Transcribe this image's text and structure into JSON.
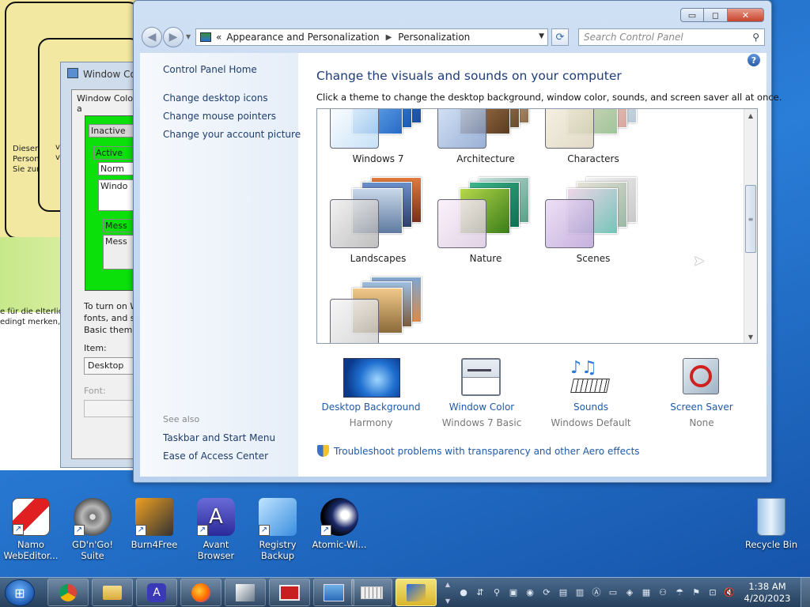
{
  "background_windows": {
    "card_text": [
      "Dieser .",
      "Person",
      "Sie zun"
    ],
    "card_text2": [
      "v",
      "v"
    ],
    "german_text": [
      "e für die elterlich",
      "edingt merken, c"
    ],
    "window_color_dialog": {
      "title": "Window Co",
      "tab": "Window Color a",
      "preview": [
        "Inactive",
        "Active",
        "Norm",
        "Windo",
        "Mess",
        "Mess"
      ],
      "help": [
        "To turn on W",
        "fonts, and si",
        "Basic theme"
      ],
      "item_label": "Item:",
      "item_value": "Desktop",
      "font_label": "Font:"
    }
  },
  "window": {
    "caption": {
      "minimize": "▭",
      "maximize": "◻",
      "close": "✕"
    },
    "breadcrumb": {
      "prefix": "«",
      "items": [
        "Appearance and Personalization",
        "Personalization"
      ]
    },
    "search": {
      "placeholder": "Search Control Panel"
    },
    "left_pane": {
      "links": [
        "Control Panel Home",
        "Change desktop icons",
        "Change mouse pointers",
        "Change your account picture"
      ],
      "see_also_label": "See also",
      "see_also": [
        "Taskbar and Start Menu",
        "Ease of Access Center"
      ]
    },
    "heading": "Change the visuals and sounds on your computer",
    "subheading": "Click a theme to change the desktop background, window color, sounds, and screen saver all at once.",
    "themes": [
      "Windows 7",
      "Architecture",
      "Characters",
      "Landscapes",
      "Nature",
      "Scenes",
      ""
    ],
    "tiles": [
      {
        "label": "Desktop Background",
        "value": "Harmony"
      },
      {
        "label": "Window Color",
        "value": "Windows 7 Basic"
      },
      {
        "label": "Sounds",
        "value": "Windows Default"
      },
      {
        "label": "Screen Saver",
        "value": "None"
      }
    ],
    "troubleshoot_link": "Troubleshoot problems with transparency and other Aero effects"
  },
  "desktop_icons": [
    {
      "label": "Namo WebEditor..."
    },
    {
      "label": "GD'n'Go! Suite"
    },
    {
      "label": "Burn4Free"
    },
    {
      "label": "Avant Browser"
    },
    {
      "label": "Registry Backup"
    },
    {
      "label": "Atomic-Wi..."
    },
    {
      "label": "Recycle Bin"
    }
  ],
  "taskbar": {
    "time": "1:38 AM",
    "date": "4/20/2023"
  },
  "colors": {
    "accent": "#1e3c78",
    "link": "#1f5aa8",
    "taskbar": "#263f5c"
  }
}
